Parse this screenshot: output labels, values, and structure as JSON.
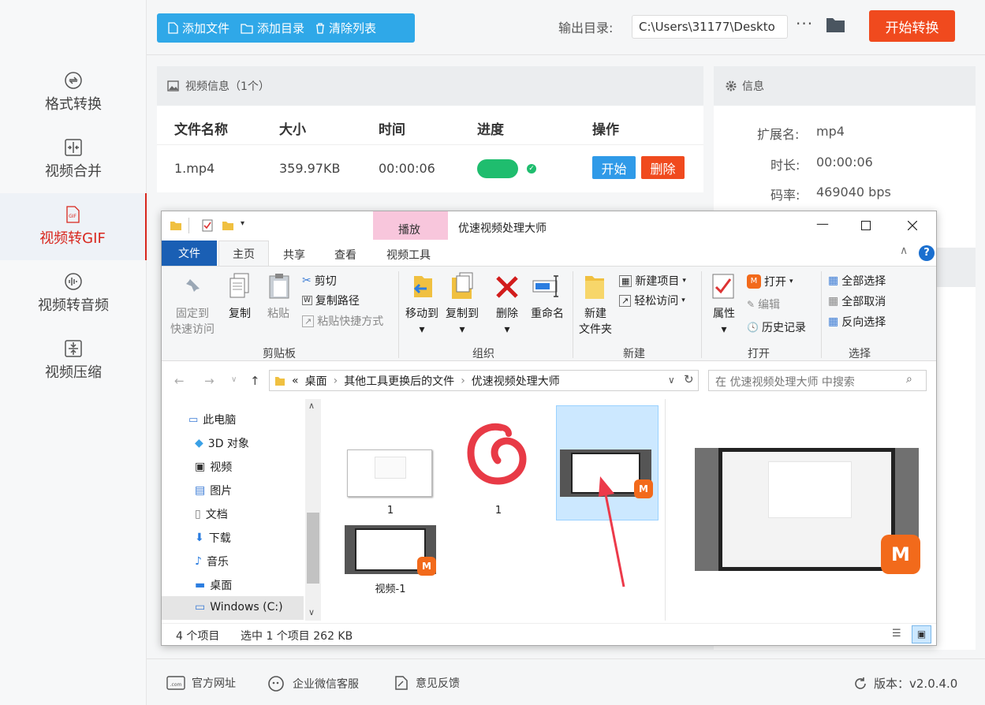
{
  "sidebar": {
    "items": [
      {
        "label": "格式转换",
        "icon": "refresh-circle-icon"
      },
      {
        "label": "视频合并",
        "icon": "merge-icon"
      },
      {
        "label": "视频转GIF",
        "icon": "gif-file-icon"
      },
      {
        "label": "视频转音频",
        "icon": "audio-wave-icon"
      },
      {
        "label": "视频压缩",
        "icon": "compress-icon"
      }
    ],
    "active_index": 2
  },
  "toolbar": {
    "add_file": "添加文件",
    "add_folder": "添加目录",
    "clear_list": "清除列表",
    "output_label": "输出目录:",
    "output_path": "C:\\Users\\31177\\Deskto",
    "more": "···",
    "start": "开始转换"
  },
  "video_panel": {
    "title": "视频信息（1个）",
    "columns": [
      "文件名称",
      "大小",
      "时间",
      "进度",
      "操作"
    ],
    "rows": [
      {
        "name": "1.mp4",
        "size": "359.97KB",
        "time": "00:00:06",
        "progress": 1.0,
        "start": "开始",
        "delete": "删除"
      }
    ]
  },
  "info_panel": {
    "title": "信息",
    "rows": [
      {
        "k": "扩展名:",
        "v": "mp4"
      },
      {
        "k": "时长:",
        "v": "00:00:06"
      },
      {
        "k": "码率:",
        "v": "469040 bps"
      }
    ]
  },
  "footer": {
    "website": "官方网址",
    "wechat": "企业微信客服",
    "feedback": "意见反馈",
    "version": "版本：v2.0.4.0"
  },
  "explorer": {
    "title": "优速视频处理大师",
    "context_tab": "播放",
    "tabs": [
      "文件",
      "主页",
      "共享",
      "查看",
      "视频工具"
    ],
    "ribbon": {
      "pin": "固定到\n快速访问",
      "copy": "复制",
      "paste": "粘贴",
      "cut": "剪切",
      "copy_path": "复制路径",
      "paste_shortcut": "粘贴快捷方式",
      "group_clipboard": "剪贴板",
      "move_to": "移动到",
      "copy_to": "复制到",
      "delete": "删除",
      "rename": "重命名",
      "group_organize": "组织",
      "new_item": "新建项目",
      "easy_access": "轻松访问",
      "new_folder": "新建\n文件夹",
      "group_new": "新建",
      "properties": "属性",
      "open": "打开",
      "edit": "编辑",
      "history": "历史记录",
      "group_open": "打开",
      "select_all": "全部选择",
      "select_none": "全部取消",
      "invert": "反向选择",
      "group_select": "选择"
    },
    "address": {
      "prefix": "«",
      "parts": [
        "桌面",
        "其他工具更换后的文件",
        "优速视频处理大师"
      ]
    },
    "search_placeholder": "在 优速视频处理大师 中搜索",
    "tree": [
      "此电脑",
      "3D 对象",
      "视频",
      "图片",
      "文档",
      "下载",
      "音乐",
      "桌面",
      "Windows (C:)"
    ],
    "files": [
      {
        "name": "1",
        "type": "image"
      },
      {
        "name": "1",
        "type": "netease-music"
      },
      {
        "name": "",
        "type": "video",
        "selected": true
      },
      {
        "name": "视频-1",
        "type": "video"
      }
    ],
    "status": {
      "count": "4 个项目",
      "selected": "选中 1 个项目  262 KB"
    }
  }
}
